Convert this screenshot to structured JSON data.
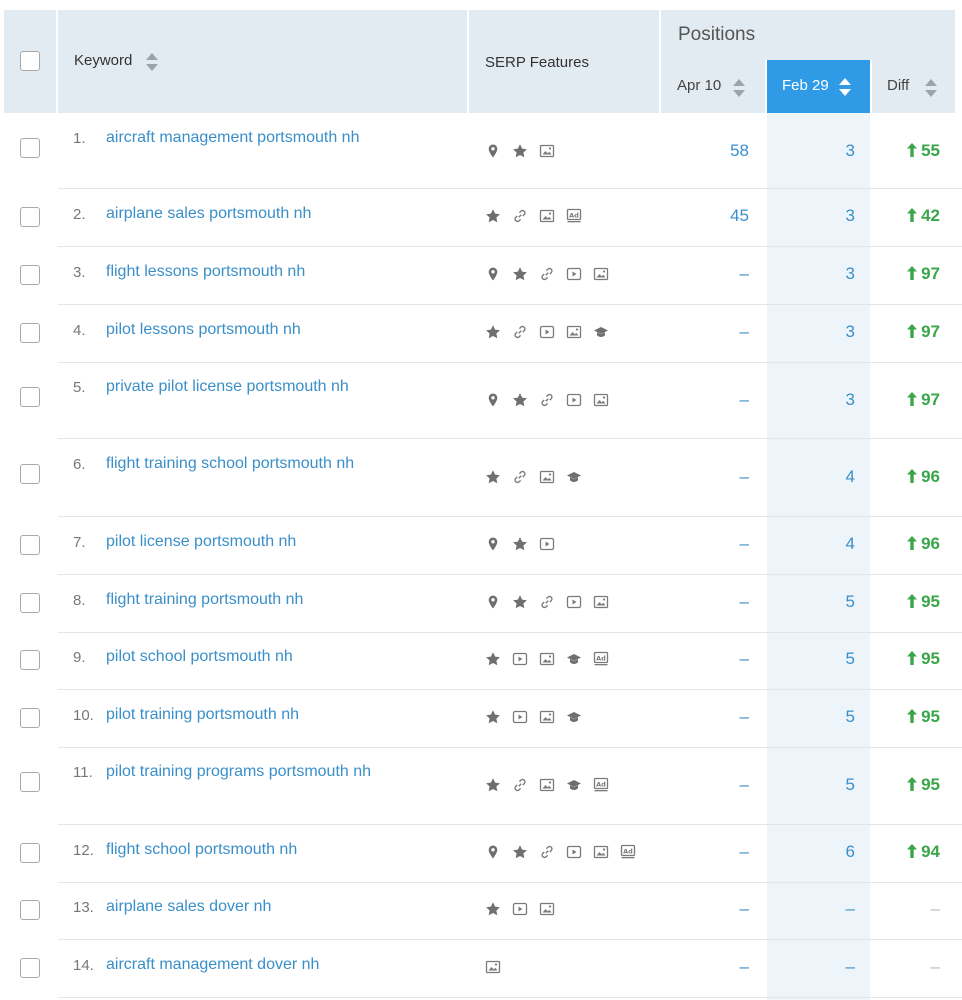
{
  "header": {
    "keyword_label": "Keyword",
    "serp_label": "SERP Features",
    "positions_label": "Positions",
    "apr_label": "Apr 10",
    "feb_label": "Feb 29",
    "diff_label": "Diff"
  },
  "colors": {
    "accent": "#2f9ae6",
    "link": "#3a8fc9",
    "up": "#3aa64a",
    "header_bg": "#e3ebf2"
  },
  "rows": [
    {
      "num": "1.",
      "keyword": "aircraft management portsmouth nh",
      "icons": [
        "pin",
        "star",
        "image"
      ],
      "apr": "58",
      "feb": "3",
      "diff": "55",
      "up": true
    },
    {
      "num": "2.",
      "keyword": "airplane sales portsmouth nh",
      "icons": [
        "star",
        "link",
        "image",
        "ad"
      ],
      "apr": "45",
      "feb": "3",
      "diff": "42",
      "up": true
    },
    {
      "num": "3.",
      "keyword": "flight lessons portsmouth nh",
      "icons": [
        "pin",
        "star",
        "link",
        "video",
        "image"
      ],
      "apr": "–",
      "feb": "3",
      "diff": "97",
      "up": true
    },
    {
      "num": "4.",
      "keyword": "pilot lessons portsmouth nh",
      "icons": [
        "star",
        "link",
        "video",
        "image",
        "cap"
      ],
      "apr": "–",
      "feb": "3",
      "diff": "97",
      "up": true
    },
    {
      "num": "5.",
      "keyword": "private pilot license portsmouth nh",
      "icons": [
        "pin",
        "star",
        "link",
        "video",
        "image"
      ],
      "apr": "–",
      "feb": "3",
      "diff": "97",
      "up": true
    },
    {
      "num": "6.",
      "keyword": "flight training school portsmouth nh",
      "icons": [
        "star",
        "link",
        "image",
        "cap"
      ],
      "apr": "–",
      "feb": "4",
      "diff": "96",
      "up": true
    },
    {
      "num": "7.",
      "keyword": "pilot license portsmouth nh",
      "icons": [
        "pin",
        "star",
        "video"
      ],
      "apr": "–",
      "feb": "4",
      "diff": "96",
      "up": true
    },
    {
      "num": "8.",
      "keyword": "flight training portsmouth nh",
      "icons": [
        "pin",
        "star",
        "link",
        "video",
        "image"
      ],
      "apr": "–",
      "feb": "5",
      "diff": "95",
      "up": true
    },
    {
      "num": "9.",
      "keyword": "pilot school portsmouth nh",
      "icons": [
        "star",
        "video",
        "image",
        "cap",
        "ad"
      ],
      "apr": "–",
      "feb": "5",
      "diff": "95",
      "up": true
    },
    {
      "num": "10.",
      "keyword": "pilot training portsmouth nh",
      "icons": [
        "star",
        "video",
        "image",
        "cap"
      ],
      "apr": "–",
      "feb": "5",
      "diff": "95",
      "up": true
    },
    {
      "num": "11.",
      "keyword": "pilot training programs portsmouth nh",
      "icons": [
        "star",
        "link",
        "image",
        "cap",
        "ad"
      ],
      "apr": "–",
      "feb": "5",
      "diff": "95",
      "up": true
    },
    {
      "num": "12.",
      "keyword": "flight school portsmouth nh",
      "icons": [
        "pin",
        "star",
        "link",
        "video",
        "image",
        "ad"
      ],
      "apr": "–",
      "feb": "6",
      "diff": "94",
      "up": true
    },
    {
      "num": "13.",
      "keyword": "airplane sales dover nh",
      "icons": [
        "star",
        "video",
        "image"
      ],
      "apr": "–",
      "feb": "–",
      "diff": "–",
      "up": false
    },
    {
      "num": "14.",
      "keyword": "aircraft management dover nh",
      "icons": [
        "image"
      ],
      "apr": "–",
      "feb": "–",
      "diff": "–",
      "up": false
    }
  ]
}
